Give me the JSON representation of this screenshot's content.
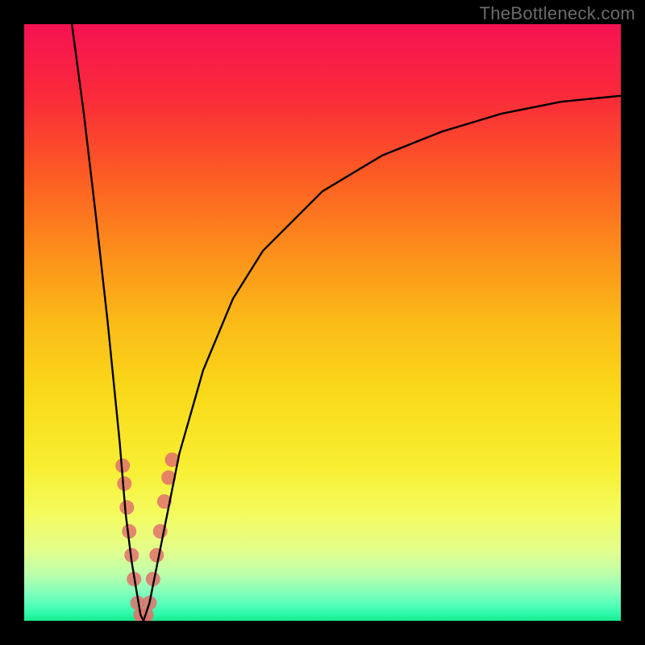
{
  "watermark": "TheBottleneck.com",
  "chart_data": {
    "type": "line",
    "title": "",
    "xlabel": "",
    "ylabel": "",
    "xlim": [
      0,
      100
    ],
    "ylim": [
      0,
      100
    ],
    "series": [
      {
        "name": "bottleneck-curve-left",
        "x": [
          8,
          10,
          12,
          14,
          16,
          17,
          18,
          19,
          19.5,
          20
        ],
        "y": [
          100,
          85,
          68,
          50,
          30,
          18,
          10,
          4,
          1,
          0
        ]
      },
      {
        "name": "bottleneck-curve-right",
        "x": [
          20,
          21,
          22,
          24,
          26,
          30,
          35,
          40,
          50,
          60,
          70,
          80,
          90,
          100
        ],
        "y": [
          0,
          3,
          8,
          18,
          28,
          42,
          54,
          62,
          72,
          78,
          82,
          85,
          87,
          88
        ]
      }
    ],
    "markers": {
      "name": "highlight-points",
      "color": "#e0716b",
      "points": [
        {
          "x": 16.5,
          "y": 26
        },
        {
          "x": 16.8,
          "y": 23
        },
        {
          "x": 17.2,
          "y": 19
        },
        {
          "x": 17.6,
          "y": 15
        },
        {
          "x": 18.0,
          "y": 11
        },
        {
          "x": 18.4,
          "y": 7
        },
        {
          "x": 19.0,
          "y": 3
        },
        {
          "x": 19.5,
          "y": 1
        },
        {
          "x": 20.0,
          "y": 0
        },
        {
          "x": 20.5,
          "y": 1
        },
        {
          "x": 21.0,
          "y": 3
        },
        {
          "x": 21.6,
          "y": 7
        },
        {
          "x": 22.2,
          "y": 11
        },
        {
          "x": 22.8,
          "y": 15
        },
        {
          "x": 23.5,
          "y": 20
        },
        {
          "x": 24.2,
          "y": 24
        },
        {
          "x": 24.8,
          "y": 27
        }
      ]
    }
  }
}
